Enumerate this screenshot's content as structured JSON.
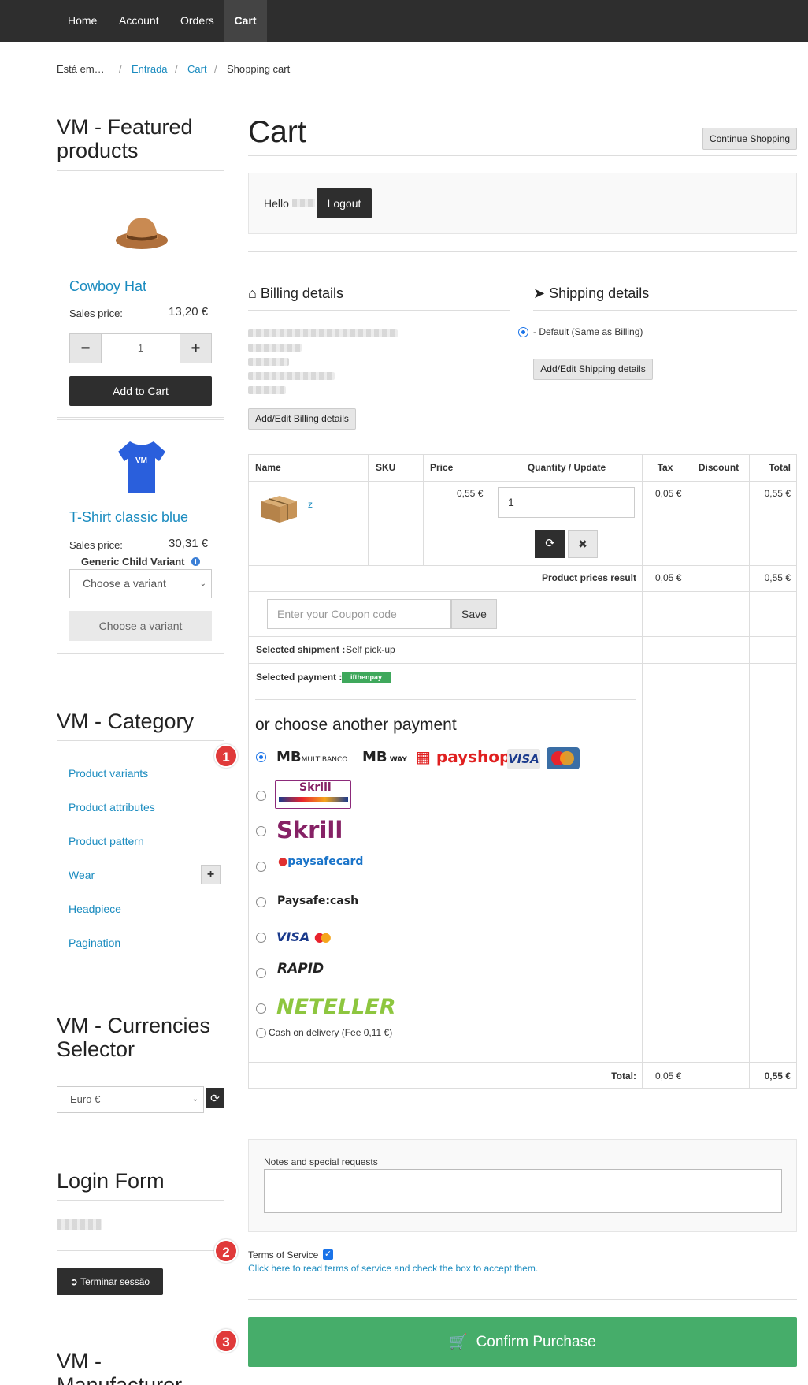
{
  "nav": {
    "items": [
      "Home",
      "Account",
      "Orders",
      "Cart"
    ]
  },
  "breadcrumb": {
    "prefix": "Está em…",
    "items": [
      "Entrada",
      "Cart",
      "Shopping cart"
    ]
  },
  "sidebar": {
    "featured_title": "VM - Featured products",
    "products": [
      {
        "name": "Cowboy Hat",
        "price_label": "Sales price:",
        "price": "13,20 €",
        "qty": "1",
        "minus": "−",
        "plus": "+",
        "add_label": "Add to Cart"
      },
      {
        "name": "T-Shirt classic blue",
        "price_label": "Sales price:",
        "price": "30,31 €",
        "variant_label": "Generic Child Variant",
        "variant_placeholder": "Choose a variant",
        "variant_button": "Choose a variant"
      }
    ],
    "category_title": "VM - Category",
    "categories": [
      "Product variants",
      "Product attributes",
      "Product pattern",
      "Wear",
      "Headpiece",
      "Pagination"
    ],
    "wear_toggle": "+",
    "currency_title": "VM - Currencies Selector",
    "currency_value": "Euro €",
    "login_title": "Login Form",
    "logout_button": "Terminar sessão",
    "manufacturer_title": "VM - Manufacturer"
  },
  "cart": {
    "title": "Cart",
    "continue_shopping": "Continue Shopping",
    "hello": "Hello",
    "logout": "Logout",
    "billing_title": "Billing details",
    "shipping_title": "Shipping details",
    "shipping_default": "- Default (Same as Billing)",
    "edit_shipping": "Add/Edit Shipping details",
    "edit_billing": "Add/Edit Billing details",
    "columns": [
      "Name",
      "SKU",
      "Price",
      "Quantity / Update",
      "Tax",
      "Discount",
      "Total"
    ],
    "item": {
      "name": "z",
      "price": "0,55 €",
      "qty": "1",
      "tax": "0,05 €",
      "total": "0,55 €"
    },
    "prices_result_label": "Product prices result",
    "prices_result_tax": "0,05 €",
    "prices_result_total": "0,55 €",
    "coupon_placeholder": "Enter your Coupon code",
    "coupon_save": "Save",
    "shipment_label": "Selected shipment :",
    "shipment_value": "Self pick-up",
    "payment_label": "Selected payment :",
    "payment_value": "ifthenpay",
    "choose_payment": "or choose another payment",
    "payment_options": [
      "MULTIBANCO",
      "MB WAY",
      "payshop",
      "VISA",
      "MasterCard",
      "Skrill",
      "Skrill",
      "paysafecard",
      "Paysafe:cash",
      "VISA",
      "RAPID",
      "NETELLER"
    ],
    "cod_label": "Cash on delivery (Fee 0,11 €)",
    "total_label": "Total:",
    "total_tax": "0,05 €",
    "total_value": "0,55 €",
    "notes_label": "Notes and special requests",
    "tos_label": "Terms of Service",
    "tos_link": "Click here to read terms of service and check the box to accept them.",
    "confirm": "Confirm Purchase"
  },
  "markers": [
    "1",
    "2",
    "3"
  ],
  "colors": {
    "nav": "#2e2e2e",
    "link": "#1a8bbf",
    "confirm": "#46ad6a",
    "marker": "#e03a3a"
  }
}
